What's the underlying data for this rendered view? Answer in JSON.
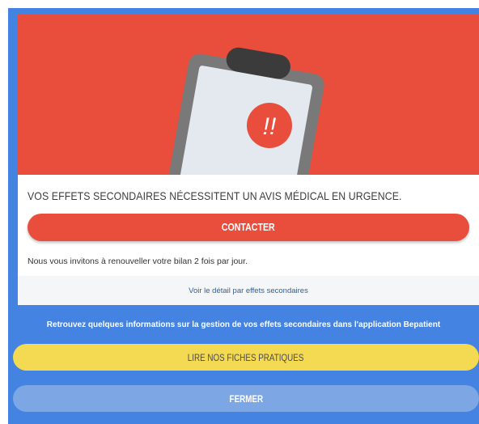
{
  "card": {
    "headline": "VOS EFFETS SECONDAIRES NÉCESSITENT UN AVIS MÉDICAL EN URGENCE.",
    "contact_label": "CONTACTER",
    "advice": "Nous vous invitons à renouveller votre bilan 2 fois par jour.",
    "detail_link": "Voir le détail par effets secondaires",
    "alert_symbol": "!!"
  },
  "info_text": "Retrouvez quelques informations sur la gestion de vos effets secondaires dans l'application Bepatient",
  "read_label": "LIRE NOS FICHES PRATIQUES",
  "close_label": "FERMER",
  "colors": {
    "background_blue": "#4583e2",
    "alert_red": "#e94e3d",
    "yellow": "#f4da52",
    "light_blue": "#7da6e5",
    "clipboard_gray": "#797979",
    "paper": "#e3e9ee"
  },
  "icons": {
    "hero": "clipboard-icon",
    "alert": "alert-icon"
  }
}
